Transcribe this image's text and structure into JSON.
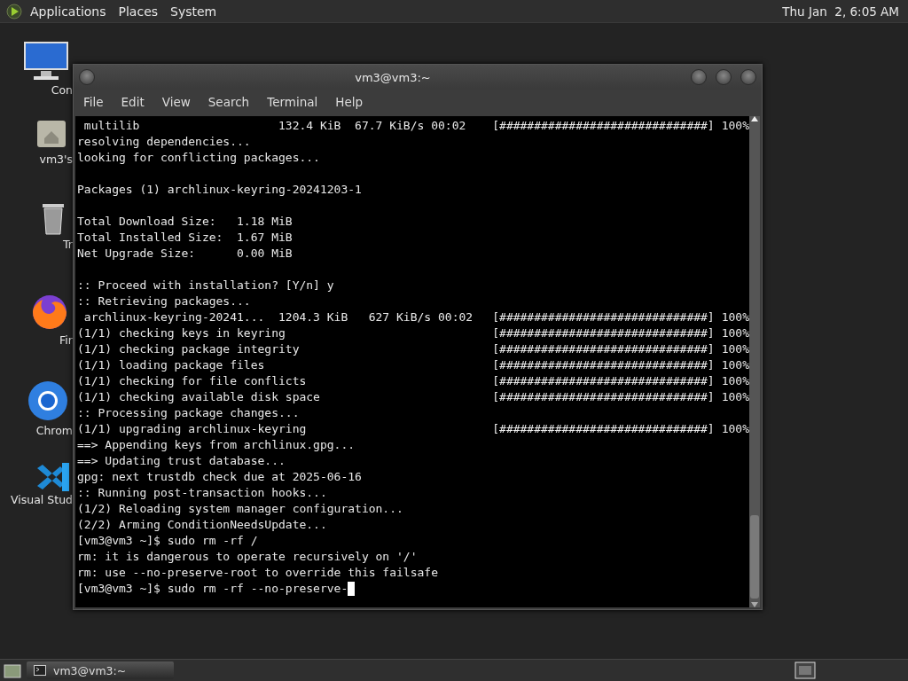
{
  "top_panel": {
    "menus": [
      "Applications",
      "Places",
      "System"
    ],
    "clock": "Thu Jan  2, 6:05 AM"
  },
  "desktop_icons": [
    {
      "kind": "computer",
      "label": "Con"
    },
    {
      "kind": "home",
      "label": "vm3's"
    },
    {
      "kind": "trash",
      "label": "Tr"
    },
    {
      "kind": "firefox",
      "label": "Fir"
    },
    {
      "kind": "chrome",
      "label": "Chrom"
    },
    {
      "kind": "vscode",
      "label": "Visual Stud"
    }
  ],
  "window": {
    "title": "vm3@vm3:~",
    "menus": [
      "File",
      "Edit",
      "View",
      "Search",
      "Terminal",
      "Help"
    ],
    "lines": [
      {
        "kind": "text",
        "text": " multilib                    132.4 KiB  67.7 KiB/s 00:02",
        "progress": "[##############################]",
        "percent": "100%"
      },
      {
        "kind": "text",
        "text": "resolving dependencies..."
      },
      {
        "kind": "text",
        "text": "looking for conflicting packages..."
      },
      {
        "kind": "blank"
      },
      {
        "kind": "text",
        "text": "Packages (1) archlinux-keyring-20241203-1"
      },
      {
        "kind": "blank"
      },
      {
        "kind": "text",
        "text": "Total Download Size:   1.18 MiB"
      },
      {
        "kind": "text",
        "text": "Total Installed Size:  1.67 MiB"
      },
      {
        "kind": "text",
        "text": "Net Upgrade Size:      0.00 MiB"
      },
      {
        "kind": "blank"
      },
      {
        "kind": "text",
        "text": ":: Proceed with installation? [Y/n] y"
      },
      {
        "kind": "text",
        "text": ":: Retrieving packages..."
      },
      {
        "kind": "text",
        "text": " archlinux-keyring-20241...  1204.3 KiB   627 KiB/s 00:02",
        "progress": "[##############################]",
        "percent": "100%"
      },
      {
        "kind": "text",
        "text": "(1/1) checking keys in keyring",
        "progress": "[##############################]",
        "percent": "100%"
      },
      {
        "kind": "text",
        "text": "(1/1) checking package integrity",
        "progress": "[##############################]",
        "percent": "100%"
      },
      {
        "kind": "text",
        "text": "(1/1) loading package files",
        "progress": "[##############################]",
        "percent": "100%"
      },
      {
        "kind": "text",
        "text": "(1/1) checking for file conflicts",
        "progress": "[##############################]",
        "percent": "100%"
      },
      {
        "kind": "text",
        "text": "(1/1) checking available disk space",
        "progress": "[##############################]",
        "percent": "100%"
      },
      {
        "kind": "text",
        "text": ":: Processing package changes..."
      },
      {
        "kind": "text",
        "text": "(1/1) upgrading archlinux-keyring",
        "progress": "[##############################]",
        "percent": "100%"
      },
      {
        "kind": "text",
        "text": "==> Appending keys from archlinux.gpg..."
      },
      {
        "kind": "text",
        "text": "==> Updating trust database..."
      },
      {
        "kind": "text",
        "text": "gpg: next trustdb check due at 2025-06-16"
      },
      {
        "kind": "text",
        "text": ":: Running post-transaction hooks..."
      },
      {
        "kind": "text",
        "text": "(1/2) Reloading system manager configuration..."
      },
      {
        "kind": "text",
        "text": "(2/2) Arming ConditionNeedsUpdate..."
      },
      {
        "kind": "text",
        "text": "[vm3@vm3 ~]$ sudo rm -rf /"
      },
      {
        "kind": "text",
        "text": "rm: it is dangerous to operate recursively on '/'"
      },
      {
        "kind": "text",
        "text": "rm: use --no-preserve-root to override this failsafe"
      },
      {
        "kind": "text",
        "text": "[vm3@vm3 ~]$ sudo rm -rf --no-preserve-",
        "cursor": true
      }
    ]
  },
  "taskbar": {
    "tasks": [
      {
        "label": "vm3@vm3:~",
        "selected": true
      }
    ]
  }
}
